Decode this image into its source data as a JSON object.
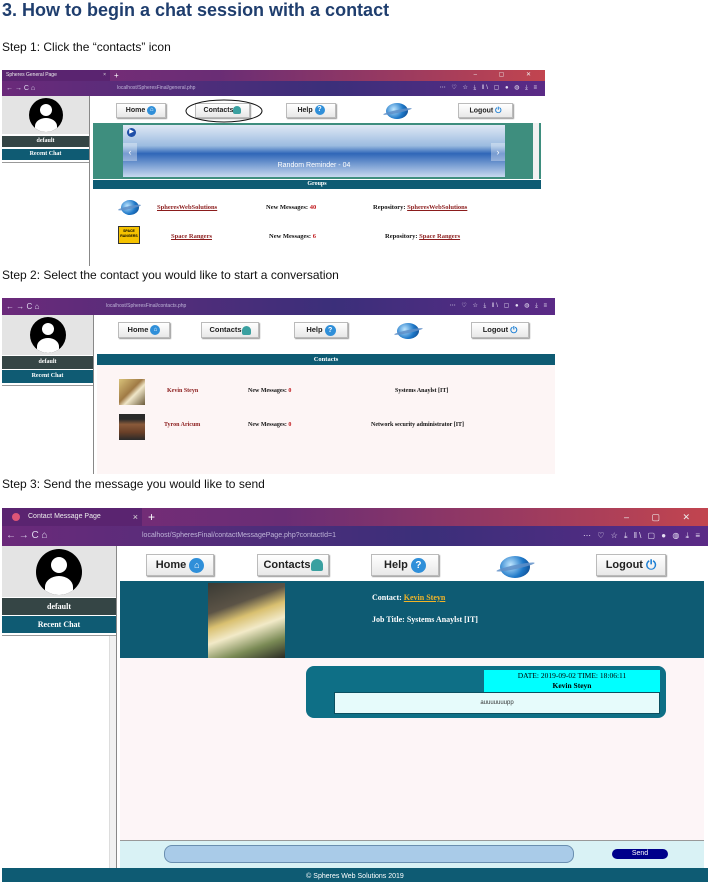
{
  "heading": "3. How to begin a chat session with a contact",
  "steps": {
    "s1": "Step 1:  Click the “contacts” icon",
    "s2": "Step 2: Select the contact you would like to start a conversation",
    "s3": "Step 3: Send the message you would like to send"
  },
  "common": {
    "new_tab": "+",
    "window_controls": "–  ▢  ✕",
    "nav_buttons": "←  →  C  ⌂",
    "nav_tools_small": "⋯ ♡ ☆   ⤓ ‖\\ ▢ ● ◍ ⤓ ≡",
    "home": "Home",
    "contacts": "Contacts",
    "help": "Help",
    "logout": "Logout",
    "default": "default",
    "recent_chat": "Recent Chat",
    "new_messages": "New Messages:",
    "repository": "Repository:"
  },
  "shot1": {
    "tab_title": "Spheres General Page",
    "url": "localhost/SpheresFinal/general.php",
    "banner_caption": "Random Reminder - 04",
    "groups_header": "Groups",
    "groups": [
      {
        "name": "SpheresWebSolutions",
        "new": "40",
        "repo": "SpheresWebSolutions"
      },
      {
        "name": "Space Rangers",
        "new": "6",
        "repo": "Space Rangers"
      }
    ],
    "space_icon_text": "SPACE RANGERS"
  },
  "shot2": {
    "url": "localhost/SpheresFinal/contacts.php",
    "contacts_header": "Contacts",
    "contacts": [
      {
        "name": "Kevin Steyn",
        "new": "0",
        "title": "Systems Anaylst [IT]"
      },
      {
        "name": "Tyron Aricum",
        "new": "0",
        "title": "Network security administrator [IT]"
      }
    ]
  },
  "shot3": {
    "tab_title": "Contact Message Page",
    "url": "localhost/SpheresFinal/contactMessagePage.php?contactId=1",
    "contact_label": "Contact:",
    "contact_name": "Kevin Steyn",
    "job_label": "Job Title: Systems Anaylst [IT]",
    "msg_date": "DATE:  2019-09-02    TIME:  18:06:11",
    "msg_sender": "Kevin Steyn",
    "msg_body": "auuuuuuupp",
    "send": "Send",
    "footer": "© Spheres Web Solutions 2019"
  }
}
